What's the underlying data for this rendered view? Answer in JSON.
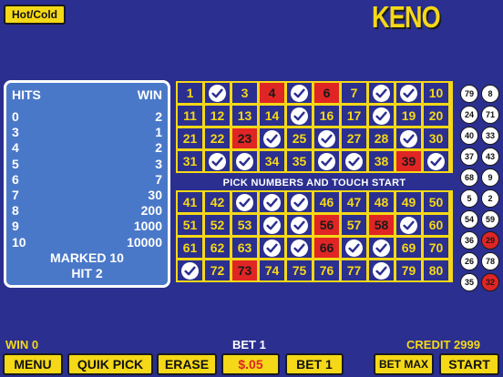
{
  "hot_cold_label": "Hot/Cold",
  "logo": "KENO",
  "paytable": {
    "hits_label": "HITS",
    "win_label": "WIN",
    "rows": [
      {
        "hits": "0",
        "win": "2"
      },
      {
        "hits": "3",
        "win": "1"
      },
      {
        "hits": "4",
        "win": "2"
      },
      {
        "hits": "5",
        "win": "3"
      },
      {
        "hits": "6",
        "win": "7"
      },
      {
        "hits": "7",
        "win": "30"
      },
      {
        "hits": "8",
        "win": "200"
      },
      {
        "hits": "9",
        "win": "1000"
      },
      {
        "hits": "10",
        "win": "10000"
      }
    ],
    "marked": "MARKED 10",
    "hit": "HIT 2"
  },
  "pick_message": "PICK NUMBERS AND TOUCH START",
  "board": {
    "red": [
      4,
      6,
      23,
      39,
      56,
      58,
      66,
      73
    ],
    "marked": [
      2,
      5,
      8,
      9,
      15,
      18,
      24,
      26,
      29,
      32,
      33,
      36,
      37,
      40,
      43,
      44,
      45,
      54,
      55,
      59,
      64,
      65,
      67,
      68,
      71,
      78
    ],
    "colors": {
      "board": "#f5d817",
      "cell": "#2b2f8f",
      "hit": "#e02525",
      "number": "#f5d817"
    }
  },
  "hot_cold": {
    "left": [
      {
        "n": "79",
        "red": false
      },
      {
        "n": "24",
        "red": false
      },
      {
        "n": "40",
        "red": false
      },
      {
        "n": "37",
        "red": false
      },
      {
        "n": "68",
        "red": false
      },
      {
        "n": "5",
        "red": false
      },
      {
        "n": "54",
        "red": false
      },
      {
        "n": "36",
        "red": false
      },
      {
        "n": "26",
        "red": false
      },
      {
        "n": "35",
        "red": false
      }
    ],
    "right": [
      {
        "n": "8",
        "red": false
      },
      {
        "n": "71",
        "red": false
      },
      {
        "n": "33",
        "red": false
      },
      {
        "n": "43",
        "red": false
      },
      {
        "n": "9",
        "red": false
      },
      {
        "n": "2",
        "red": false
      },
      {
        "n": "59",
        "red": false
      },
      {
        "n": "29",
        "red": true
      },
      {
        "n": "78",
        "red": false
      },
      {
        "n": "32",
        "red": true
      }
    ]
  },
  "status": {
    "win": "WIN 0",
    "bet": "BET 1",
    "credit": "CREDIT 2999"
  },
  "buttons": {
    "menu": "MENU",
    "quik_pick": "QUIK PICK",
    "erase": "ERASE",
    "denom": "$.05",
    "bet_one": "BET 1",
    "bet_max": "BET MAX",
    "start": "START"
  },
  "accent_color": "#f5d817",
  "background_color": "#2b2f8f"
}
